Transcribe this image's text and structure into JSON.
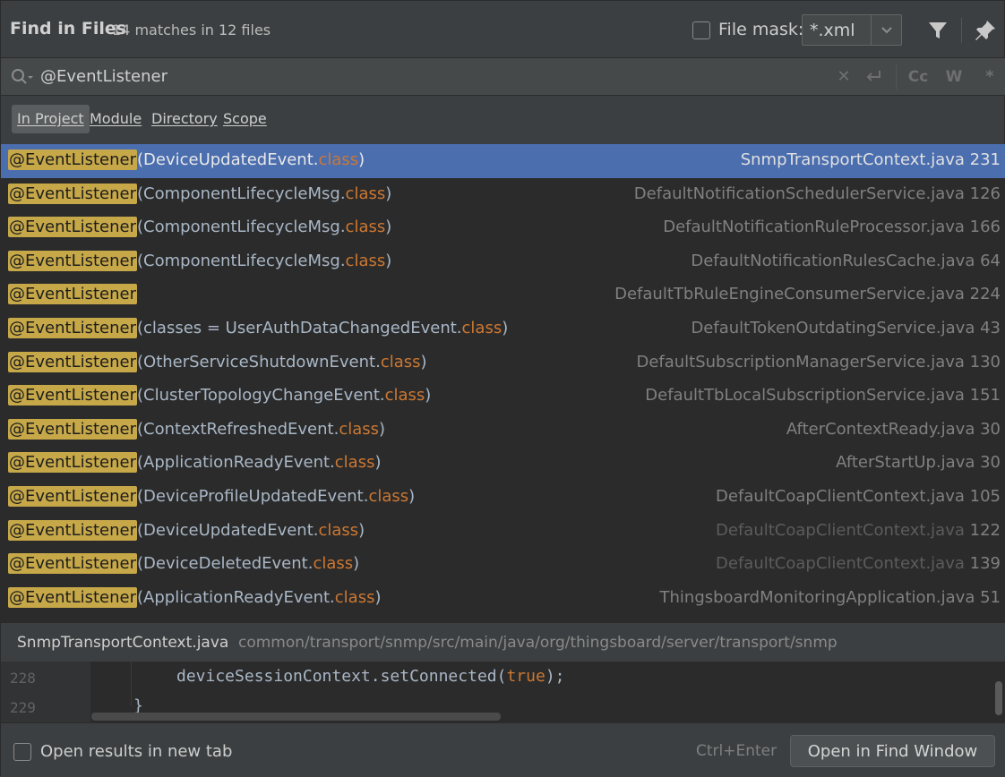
{
  "header": {
    "title": "Find in Files",
    "match_summary": "14 matches in 12 files",
    "file_mask_label": "File mask:",
    "file_mask_value": "*.xml"
  },
  "search": {
    "query": "@EventListener",
    "options": {
      "case": "Cc",
      "words": "W",
      "regex": "*"
    }
  },
  "scopes": [
    {
      "label": "In Project",
      "active": true
    },
    {
      "label": "Module",
      "active": false
    },
    {
      "label": "Directory",
      "active": false
    },
    {
      "label": "Scope",
      "active": false
    }
  ],
  "results": [
    {
      "match": "@EventListener",
      "pre": "(DeviceUpdatedEvent.",
      "kw": "class",
      "post": ")",
      "file": "SnmpTransportContext.java 231",
      "selected": true,
      "dim": false
    },
    {
      "match": "@EventListener",
      "pre": "(ComponentLifecycleMsg.",
      "kw": "class",
      "post": ")",
      "file": "DefaultNotificationSchedulerService.java 126",
      "selected": false,
      "dim": false
    },
    {
      "match": "@EventListener",
      "pre": "(ComponentLifecycleMsg.",
      "kw": "class",
      "post": ")",
      "file": "DefaultNotificationRuleProcessor.java 166",
      "selected": false,
      "dim": false
    },
    {
      "match": "@EventListener",
      "pre": "(ComponentLifecycleMsg.",
      "kw": "class",
      "post": ")",
      "file": "DefaultNotificationRulesCache.java 64",
      "selected": false,
      "dim": false
    },
    {
      "match": "@EventListener",
      "pre": "",
      "kw": "",
      "post": "",
      "file": "DefaultTbRuleEngineConsumerService.java 224",
      "selected": false,
      "dim": false
    },
    {
      "match": "@EventListener",
      "pre": "(classes = UserAuthDataChangedEvent.",
      "kw": "class",
      "post": ")",
      "file": "DefaultTokenOutdatingService.java 43",
      "selected": false,
      "dim": false
    },
    {
      "match": "@EventListener",
      "pre": "(OtherServiceShutdownEvent.",
      "kw": "class",
      "post": ")",
      "file": "DefaultSubscriptionManagerService.java 130",
      "selected": false,
      "dim": false
    },
    {
      "match": "@EventListener",
      "pre": "(ClusterTopologyChangeEvent.",
      "kw": "class",
      "post": ")",
      "file": "DefaultTbLocalSubscriptionService.java 151",
      "selected": false,
      "dim": false
    },
    {
      "match": "@EventListener",
      "pre": "(ContextRefreshedEvent.",
      "kw": "class",
      "post": ")",
      "file": "AfterContextReady.java 30",
      "selected": false,
      "dim": false
    },
    {
      "match": "@EventListener",
      "pre": "(ApplicationReadyEvent.",
      "kw": "class",
      "post": ")",
      "file": "AfterStartUp.java 30",
      "selected": false,
      "dim": false
    },
    {
      "match": "@EventListener",
      "pre": "(DeviceProfileUpdatedEvent.",
      "kw": "class",
      "post": ")",
      "file": "DefaultCoapClientContext.java 105",
      "selected": false,
      "dim": false
    },
    {
      "match": "@EventListener",
      "pre": "(DeviceUpdatedEvent.",
      "kw": "class",
      "post": ")",
      "file_name": "DefaultCoapClientContext.java",
      "file_line": "122",
      "selected": false,
      "dim": true
    },
    {
      "match": "@EventListener",
      "pre": "(DeviceDeletedEvent.",
      "kw": "class",
      "post": ")",
      "file_name": "DefaultCoapClientContext.java",
      "file_line": "139",
      "selected": false,
      "dim": true
    },
    {
      "match": "@EventListener",
      "pre": "(ApplicationReadyEvent.",
      "kw": "class",
      "post": ")",
      "file": "ThingsboardMonitoringApplication.java 51",
      "selected": false,
      "dim": false
    }
  ],
  "preview": {
    "file_name": "SnmpTransportContext.java",
    "path": "common/transport/snmp/src/main/java/org/thingsboard/server/transport/snmp",
    "lines": [
      {
        "number": "228",
        "text": "deviceSessionContext.setConnected(",
        "kw": "true",
        "tail": ");"
      },
      {
        "number": "229",
        "text": "}",
        "kw": "",
        "tail": ""
      }
    ]
  },
  "footer": {
    "open_new_tab_label": "Open results in new tab",
    "shortcut": "Ctrl+Enter",
    "open_button": "Open in Find Window"
  }
}
